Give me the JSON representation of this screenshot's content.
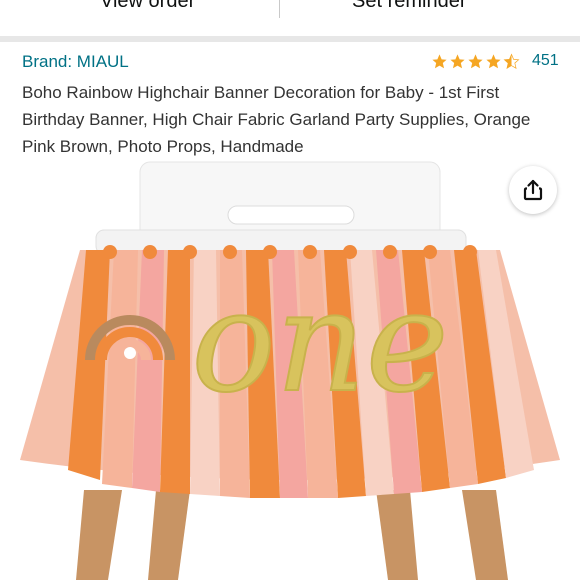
{
  "nav": {
    "left_tab": "View order",
    "right_tab": "Set reminder"
  },
  "product": {
    "brand": "Brand: MIAUL",
    "rating": {
      "stars": 4.5,
      "count": "451"
    },
    "title": "Boho Rainbow Highchair Banner Decoration for Baby - 1st First Birthday Banner, High Chair Fabric Garland Party Supplies, Orange Pink Brown, Photo Props, Handmade",
    "image": {
      "icon": "product-photo",
      "banner_word": "one",
      "colors": {
        "orange": "#f08a3c",
        "peach": "#f6b49a",
        "pink": "#f4a6a0",
        "gold": "#d8c35d",
        "brown": "#b98a5e"
      }
    }
  },
  "actions": {
    "share_icon": "share-icon"
  },
  "colors": {
    "link": "#007185",
    "star": "#f5a623",
    "text": "#333333"
  }
}
